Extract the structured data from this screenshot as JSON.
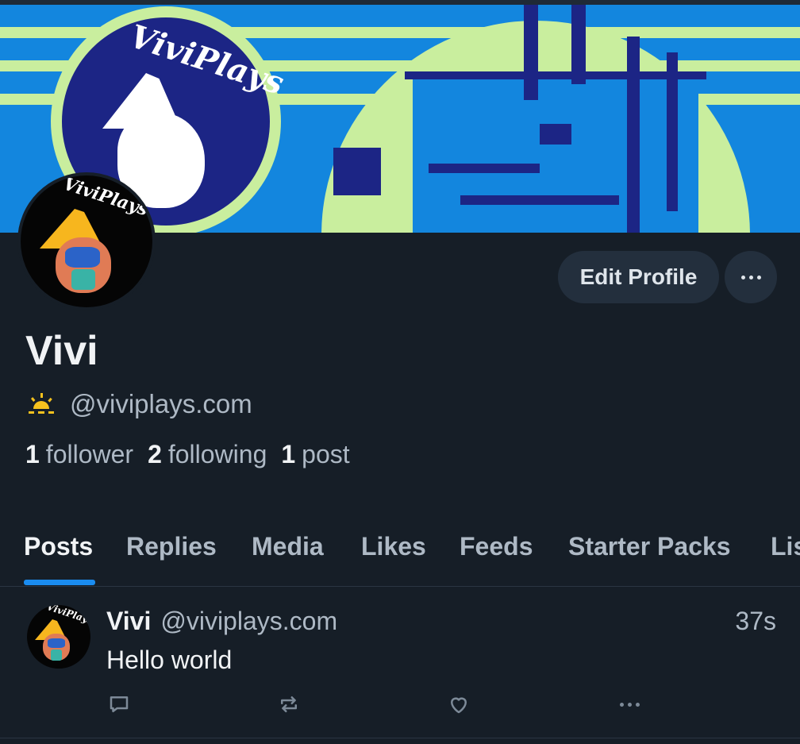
{
  "banner": {
    "badge_text": "ViviPlays",
    "colors": {
      "sky": "#1386de",
      "light": "#c9ee9e",
      "dark": "#1c2585"
    }
  },
  "avatar": {
    "text": "ViviPlays"
  },
  "actions": {
    "edit_profile": "Edit Profile",
    "more_icon": "ellipsis-icon"
  },
  "profile": {
    "display_name": "Vivi",
    "handle": "@viviplays.com",
    "handle_icon": "sunrise-icon",
    "stats": {
      "followers_count": "1",
      "followers_label": "follower",
      "following_count": "2",
      "following_label": "following",
      "posts_count": "1",
      "posts_label": "post"
    }
  },
  "tabs": [
    {
      "label": "Posts",
      "active": true
    },
    {
      "label": "Replies"
    },
    {
      "label": "Media"
    },
    {
      "label": "Likes"
    },
    {
      "label": "Feeds"
    },
    {
      "label": "Starter Packs"
    },
    {
      "label": "Lists"
    }
  ],
  "post": {
    "author_name": "Vivi",
    "author_handle": "@viviplays.com",
    "time": "37s",
    "text": "Hello world",
    "avatar_text": "ViviPlays",
    "action_icons": [
      "reply-icon",
      "repost-icon",
      "like-icon",
      "more-icon"
    ]
  },
  "accent_color": "#1a8cf0"
}
